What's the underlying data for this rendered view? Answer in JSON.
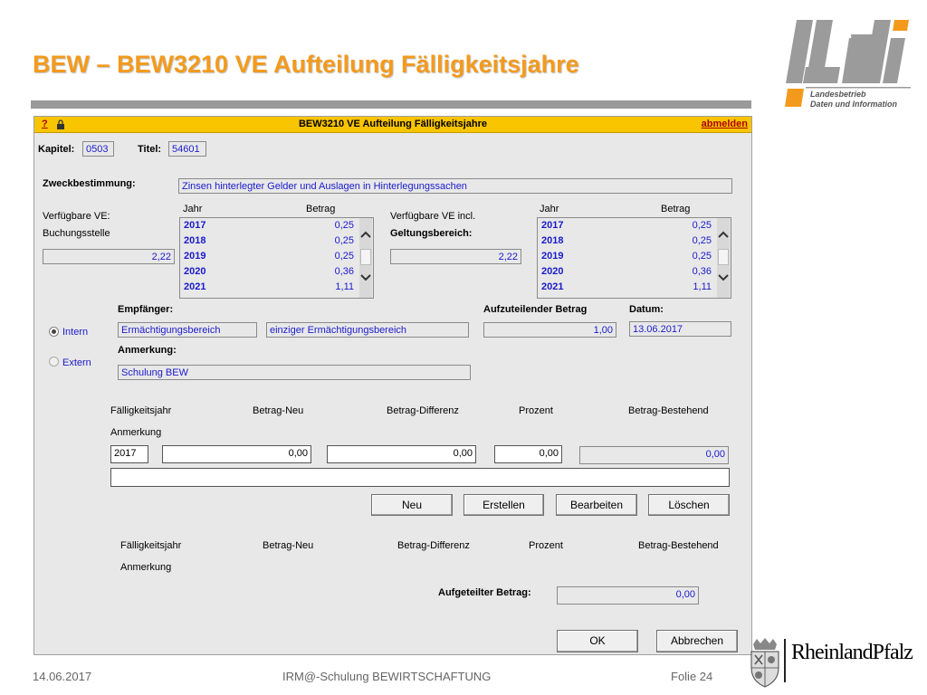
{
  "slide": {
    "title": "BEW – BEW3210 VE Aufteilung Fälligkeitsjahre",
    "logo_line1": "Landesbetrieb",
    "logo_line2": "Daten und Information",
    "footer_date": "14.06.2017",
    "footer_center": "IRM@-Schulung BEWIRTSCHAFTUNG",
    "footer_page": "Folie 24",
    "rp_logo": "RheinlandPfalz"
  },
  "window": {
    "help": "?",
    "title": "BEW3210 VE Aufteilung Fälligkeitsjahre",
    "logout": "abmelden"
  },
  "header": {
    "kapitel_label": "Kapitel:",
    "kapitel_value": "0503",
    "titel_label": "Titel:",
    "titel_value": "54601"
  },
  "zweck": {
    "label": "Zweckbestimmung:",
    "value": "Zinsen hinterlegter Gelder und Auslagen in Hinterlegungssachen"
  },
  "left_ve": {
    "label1": "Verfügbare VE:",
    "label2": "Buchungsstelle",
    "value": "2,22",
    "col_year": "Jahr",
    "col_amount": "Betrag",
    "rows": [
      {
        "year": "2017",
        "amount": "0,25"
      },
      {
        "year": "2018",
        "amount": "0,25"
      },
      {
        "year": "2019",
        "amount": "0,25"
      },
      {
        "year": "2020",
        "amount": "0,36"
      },
      {
        "year": "2021",
        "amount": "1,11"
      }
    ]
  },
  "right_ve": {
    "label1": "Verfügbare VE incl.",
    "label2": "Geltungsbereich:",
    "value": "2,22",
    "col_year": "Jahr",
    "col_amount": "Betrag",
    "rows": [
      {
        "year": "2017",
        "amount": "0,25"
      },
      {
        "year": "2018",
        "amount": "0,25"
      },
      {
        "year": "2019",
        "amount": "0,25"
      },
      {
        "year": "2020",
        "amount": "0,36"
      },
      {
        "year": "2021",
        "amount": "1,11"
      }
    ]
  },
  "empfaenger": {
    "label": "Empfänger:",
    "field1": "Ermächtigungsbereich",
    "field2": "einziger Ermächtigungsbereich",
    "aufzuteilen_label": "Aufzuteilender Betrag",
    "aufzuteilen_value": "1,00",
    "datum_label": "Datum:",
    "datum_value": "13.06.2017",
    "radio_intern": "Intern",
    "radio_extern": "Extern",
    "anmerkung_label": "Anmerkung:",
    "anmerkung_value": "Schulung BEW"
  },
  "entry": {
    "col_year": "Fälligkeitsjahr",
    "col_neu": "Betrag-Neu",
    "col_diff": "Betrag-Differenz",
    "col_prozent": "Prozent",
    "col_bestehend": "Betrag-Bestehend",
    "anmerkung": "Anmerkung",
    "year": "2017",
    "neu": "0,00",
    "diff": "0,00",
    "prozent": "0,00",
    "bestehend": "0,00",
    "note": ""
  },
  "buttons": {
    "neu": "Neu",
    "erstellen": "Erstellen",
    "bearbeiten": "Bearbeiten",
    "loeschen": "Löschen",
    "ok": "OK",
    "abbrechen": "Abbrechen"
  },
  "list": {
    "col_year": "Fälligkeitsjahr",
    "col_neu": "Betrag-Neu",
    "col_diff": "Betrag-Differenz",
    "col_prozent": "Prozent",
    "col_bestehend": "Betrag-Bestehend",
    "anmerkung": "Anmerkung",
    "aufgeteilt_label": "Aufgeteilter Betrag:",
    "aufgeteilt_value": "0,00"
  }
}
